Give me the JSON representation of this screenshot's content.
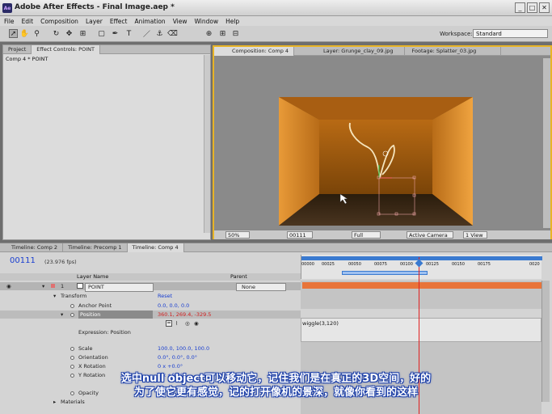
{
  "window": {
    "title": "Adobe After Effects - Final Image.aep *",
    "app_icon": "Ae",
    "controls": [
      "_",
      "□",
      "✕"
    ]
  },
  "menu": [
    "File",
    "Edit",
    "Composition",
    "Layer",
    "Effect",
    "Animation",
    "View",
    "Window",
    "Help"
  ],
  "toolbar": {
    "workspace_label": "Workspace:",
    "workspace_value": "Standard"
  },
  "left_panel": {
    "tabs": [
      "Project",
      "Effect Controls: POINT"
    ],
    "subtitle": "Comp 4 * POINT"
  },
  "comp_panel": {
    "tabs": [
      "Composition: Comp 4",
      "Layer: Grunge_clay_09.jpg",
      "Footage: Splatter_03.jpg"
    ],
    "viewer_bar": {
      "zoom": "50%",
      "timecode": "00111",
      "resolution": "Full",
      "camera": "Active Camera",
      "views": "1 View"
    }
  },
  "timeline": {
    "tabs": [
      "Timeline: Comp 2",
      "Timeline: Precomp 1",
      "Timeline: Comp 4"
    ],
    "current_time": "00111",
    "fps": "(23.976 fps)",
    "columns": {
      "layer_name": "Layer Name",
      "parent": "Parent"
    },
    "ruler_ticks": [
      "00000",
      "00025",
      "00050",
      "00075",
      "00100",
      "00125",
      "00150",
      "00175",
      "0020"
    ],
    "layer": {
      "number": "1",
      "name": "POINT",
      "parent": "None"
    },
    "properties": [
      {
        "name": "Transform",
        "value": "Reset"
      },
      {
        "name": "Anchor Point",
        "value": "0.0, 0.0, 0.0"
      },
      {
        "name": "Position",
        "value": "360.1, 269.4, -329.5"
      },
      {
        "name": "Expression: Position",
        "value": ""
      },
      {
        "name": "Scale",
        "value": "100.0, 100.0, 100.0"
      },
      {
        "name": "Orientation",
        "value": "0.0°, 0.0°, 0.0°"
      },
      {
        "name": "X Rotation",
        "value": "0 x +0.0°"
      },
      {
        "name": "Y Rotation",
        "value": "0 x +0.0°"
      },
      {
        "name": "Opacity",
        "value": ""
      },
      {
        "name": "Materials",
        "value": ""
      }
    ],
    "expression_text": "wiggle(3,120)"
  },
  "subtitles": {
    "line1": "选中null object可以移动它，记住我们是在真正的3D空间，好的",
    "line2": "为了使它更有感觉，记的打开像机的景深，就像你看到的这样"
  },
  "colors": {
    "accent_yellow": "#e8b426",
    "time_blue": "#1a3fd0",
    "layer_bar": "#e8743a",
    "playhead": "#e02020"
  }
}
